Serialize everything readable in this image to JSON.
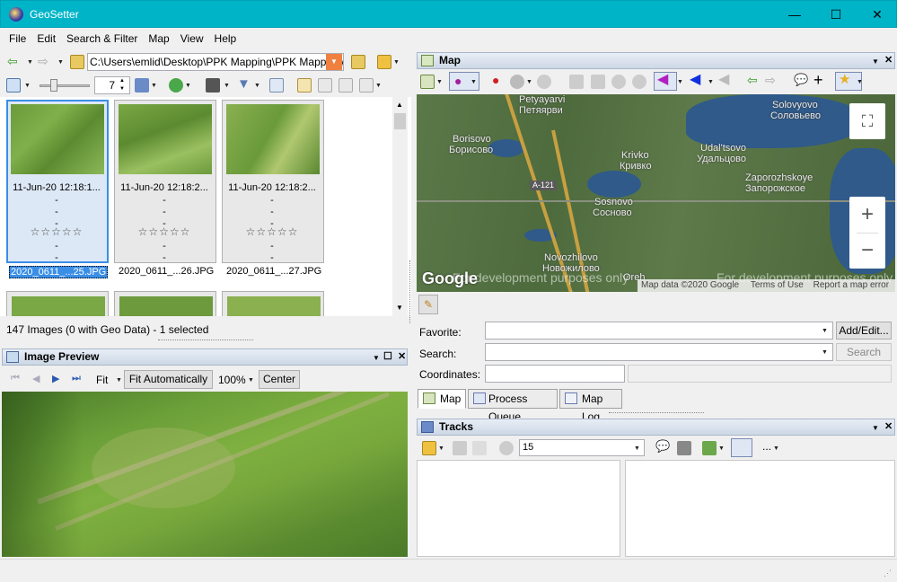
{
  "window": {
    "title": "GeoSetter",
    "minimize": "—",
    "maximize": "☐",
    "close": "✕"
  },
  "menu": [
    "File",
    "Edit",
    "Search & Filter",
    "Map",
    "View",
    "Help"
  ],
  "path_bar": {
    "path": "C:\\Users\\emlid\\Desktop\\PPK Mapping\\PPK Mapping\\Pho"
  },
  "toolbar2": {
    "thumb_size": "7"
  },
  "thumbnails": [
    {
      "date": "11-Jun-20 12:18:1...",
      "l1": "-",
      "l2": "-",
      "l3": "-",
      "stars": "☆☆☆☆☆",
      "l4": "-",
      "l5": "-",
      "name": "2020_0611_...25.JPG",
      "selected": true
    },
    {
      "date": "11-Jun-20 12:18:2...",
      "l1": "-",
      "l2": "-",
      "l3": "-",
      "stars": "☆☆☆☆☆",
      "l4": "-",
      "l5": "-",
      "name": "2020_0611_...26.JPG",
      "selected": false
    },
    {
      "date": "11-Jun-20 12:18:2...",
      "l1": "-",
      "l2": "-",
      "l3": "-",
      "stars": "☆☆☆☆☆",
      "l4": "-",
      "l5": "-",
      "name": "2020_0611_...27.JPG",
      "selected": false
    }
  ],
  "status": "147 Images (0 with Geo Data) - 1 selected",
  "preview": {
    "title": "Image Preview",
    "fit_label": "Fit",
    "fit_auto": "Fit Automatically",
    "zoom": "100%",
    "center": "Center"
  },
  "map": {
    "title": "Map",
    "labels": {
      "petyayarvi_en": "Petyayarvi",
      "petyayarvi_ru": "Петяярви",
      "borisovo_en": "Borisovo",
      "borisovo_ru": "Борисово",
      "krivko_en": "Krivko",
      "krivko_ru": "Кривко",
      "udaltsovo_en": "Udal'tsovo",
      "udaltsovo_ru": "Удальцово",
      "solovyovo_en": "Solovyovo",
      "solovyovo_ru": "Соловьево",
      "zaporozhskoye_en": "Zaporozhskoye",
      "zaporozhskoye_ru": "Запорожское",
      "sosnovo_en": "Sosnovo",
      "sosnovo_ru": "Сосново",
      "novozhilovo_en": "Novozhilovo",
      "novozhilovo_ru": "Новожилово",
      "orekhovo": "Oreh",
      "road": "A-121"
    },
    "watermark1": "For development purposes only",
    "watermark2": "For development purposes only",
    "google": "Google",
    "attribution": "Map data ©2020 Google",
    "terms": "Terms of Use",
    "report": "Report a map error",
    "zoom_in": "+",
    "zoom_out": "−",
    "fullscreen": "⛶"
  },
  "search_panel": {
    "favorite_label": "Favorite:",
    "add_edit": "Add/Edit...",
    "search_label": "Search:",
    "search_button": "Search",
    "coordinates_label": "Coordinates:"
  },
  "tabs": [
    "Map",
    "Process Queue",
    "Map Log"
  ],
  "tracks": {
    "title": "Tracks",
    "value": "15",
    "more": "..."
  },
  "colors": {
    "titlebar": "#00b4c8",
    "selection": "#3a8ee6",
    "map_bg": "#4e6b3e",
    "water": "#2f5a8a"
  }
}
